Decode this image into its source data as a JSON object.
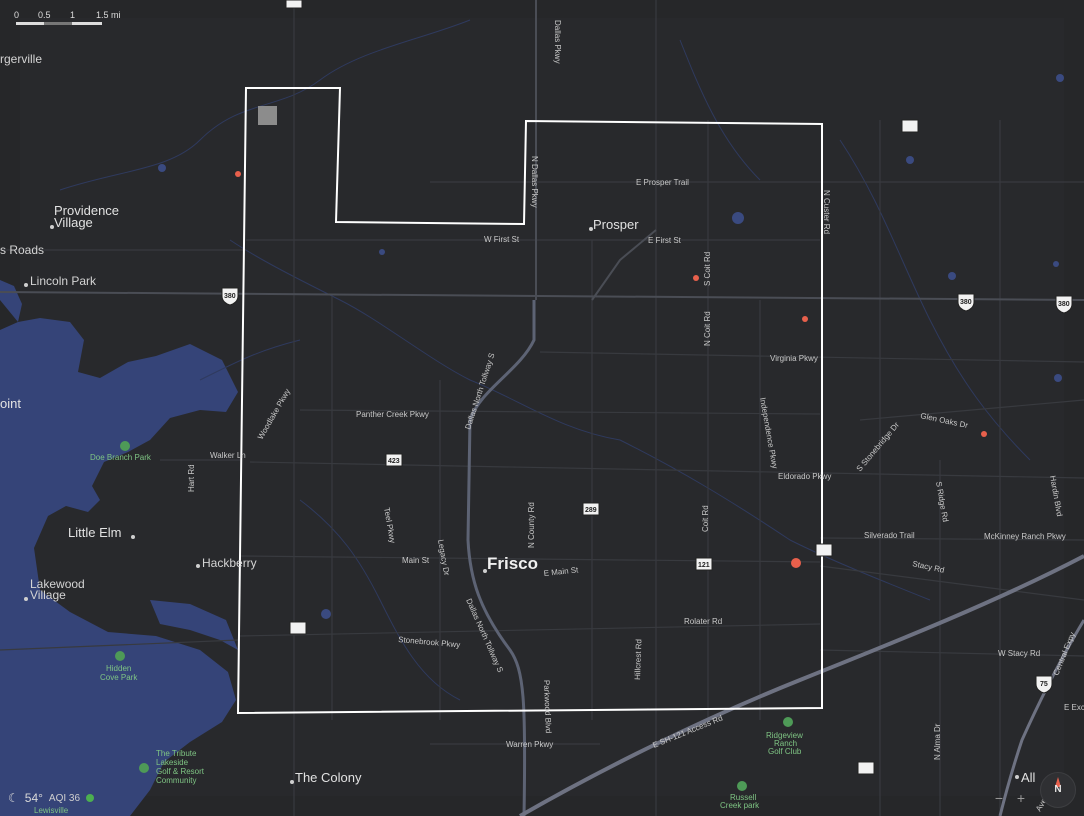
{
  "scale": {
    "labels": [
      "0",
      "0.5",
      "1",
      "1.5 mi"
    ]
  },
  "places": {
    "aubrey_partial": "rgerville",
    "providence_village_1": "Providence",
    "providence_village_2": "Village",
    "roads_partial": "s Roads",
    "lincoln_park": "Lincoln Park",
    "point_partial": "oint",
    "little_elm": "Little Elm",
    "hackberry": "Hackberry",
    "lakewood_village_1": "Lakewood",
    "lakewood_village_2": "Village",
    "prosper": "Prosper",
    "frisco": "Frisco",
    "the_colony": "The Colony",
    "allen_partial": "All",
    "lewisville_partial": "Lewisville"
  },
  "parks": {
    "doe_branch": "Doe Branch Park",
    "hidden_cove_1": "Hidden",
    "hidden_cove_2": "Cove Park",
    "tribute_1": "The Tribute",
    "tribute_2": "Lakeside",
    "tribute_3": "Golf & Resort",
    "tribute_4": "Community",
    "ridgeview_1": "Ridgeview",
    "ridgeview_2": "Ranch",
    "ridgeview_3": "Golf Club",
    "russell_1": "Russell",
    "russell_2": "Creek park"
  },
  "roads": {
    "dallas_pkwy_north": "Dallas Pkwy",
    "n_dallas_pkwy": "N Dallas Pkwy",
    "e_prosper_trail": "E Prosper Trail",
    "w_first_st": "W First St",
    "e_first_st": "E First St",
    "s_coit_rd": "S Coit Rd",
    "n_custer_rd": "N Custer Rd",
    "n_coit_rd": "N Coit Rd",
    "virginia_pkwy": "Virginia Pkwy",
    "woodlake_pkwy": "Woodlake Pkwy",
    "panther_creek_pkwy": "Panther Creek Pkwy",
    "dallas_north_tollway_s": "Dallas North Tollway S",
    "independence_pkwy": "Independence Pkwy",
    "glen_oaks_dr": "Glen Oaks Dr",
    "s_stonebridge_dr": "S Stonebridge Dr",
    "walker_ln": "Walker Ln",
    "hart_rd": "Hart Rd",
    "eldorado_pkwy": "Eldorado Pkwy",
    "teel_pkwy": "Teel Pkwy",
    "n_county_rd": "N County Rd",
    "coit_rd": "Coit Rd",
    "s_ridge_rd": "S Ridge Rd",
    "hardin_blvd": "Hardin Blvd",
    "silverado_trail": "Silverado Trail",
    "mckinney_ranch_pkwy": "McKinney Ranch Pkwy",
    "main_st": "Main St",
    "legacy_dr": "Legacy Dr",
    "e_main_st": "E Main St",
    "stacy_rd": "Stacy Rd",
    "rolater_rd": "Rolater Rd",
    "stonebrook_pkwy": "Stonebrook Pkwy",
    "dallas_north_tollway_s2": "Dallas North Tollway S",
    "hillcrest_rd": "Hillcrest Rd",
    "parkwood_blvd": "Parkwood Blvd",
    "w_stacy_rd": "W Stacy Rd",
    "central_expy": "Central Expy",
    "e_sh121_access": "E SH-121 Access Rd",
    "warren_pkwy": "Warren Pkwy",
    "n_alma_dr": "N Alma Dr",
    "e_exch_partial": "E Exc",
    "ave_partial": "Ave"
  },
  "shields": {
    "us380_west": "380",
    "us380_east": "380",
    "us380_edge": "380",
    "sh289": "289",
    "sh423": "423",
    "sh121": "121",
    "tx_top": "",
    "tx_northeast": "",
    "tx_south_a": "",
    "tx_south_b": "",
    "us75": "75"
  },
  "weather": {
    "temperature": "54°",
    "aqi": "AQI 36"
  },
  "controls": {
    "zoom_out": "−",
    "zoom_in": "+",
    "compass": "N"
  },
  "colors": {
    "land": "#262729",
    "water": "#354478",
    "boundary": "#ffffff",
    "highway": "#6e7282",
    "poi_red": "#e8604c",
    "park_green": "#7fc584"
  }
}
